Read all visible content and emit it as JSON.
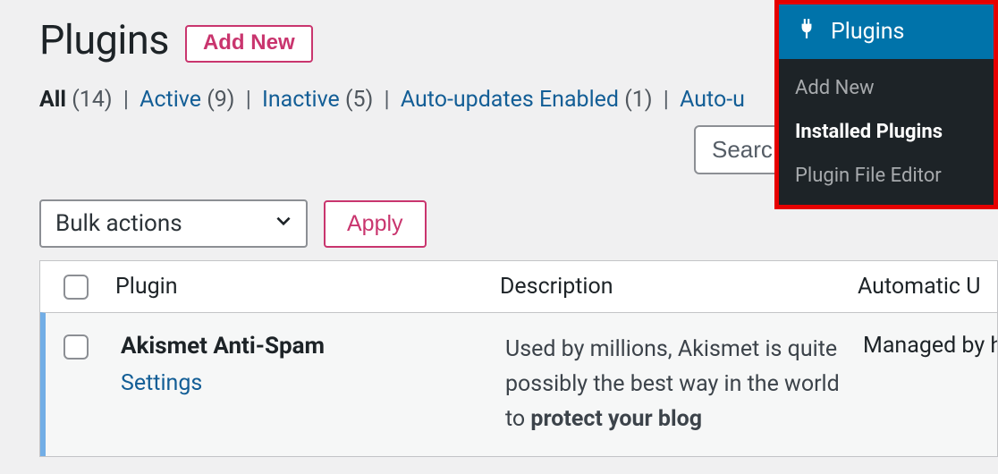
{
  "header": {
    "title": "Plugins",
    "add_new_label": "Add New"
  },
  "filters": {
    "items": [
      {
        "label": "All",
        "count": "(14)",
        "current": true
      },
      {
        "label": "Active",
        "count": "(9)",
        "current": false
      },
      {
        "label": "Inactive",
        "count": "(5)",
        "current": false
      },
      {
        "label": "Auto-updates Enabled",
        "count": "(1)",
        "current": false
      },
      {
        "label": "Auto-u",
        "count": "",
        "current": false
      }
    ],
    "separator": "|"
  },
  "search": {
    "placeholder": "Searc"
  },
  "bulk": {
    "select_label": "Bulk actions",
    "apply_label": "Apply"
  },
  "table": {
    "headers": {
      "plugin": "Plugin",
      "description": "Description",
      "auto_update": "Automatic U"
    },
    "rows": [
      {
        "name": "Akismet Anti-Spam",
        "action_label": "Settings",
        "description_pre": "Used by millions, Akismet is quite possibly the best way in the world to ",
        "description_strong": "protect your blog",
        "auto_update": "Managed by h"
      }
    ]
  },
  "admin_menu": {
    "top_label": "Plugins",
    "items": [
      {
        "label": "Add New",
        "current": false
      },
      {
        "label": "Installed Plugins",
        "current": true
      },
      {
        "label": "Plugin File Editor",
        "current": false
      }
    ]
  }
}
